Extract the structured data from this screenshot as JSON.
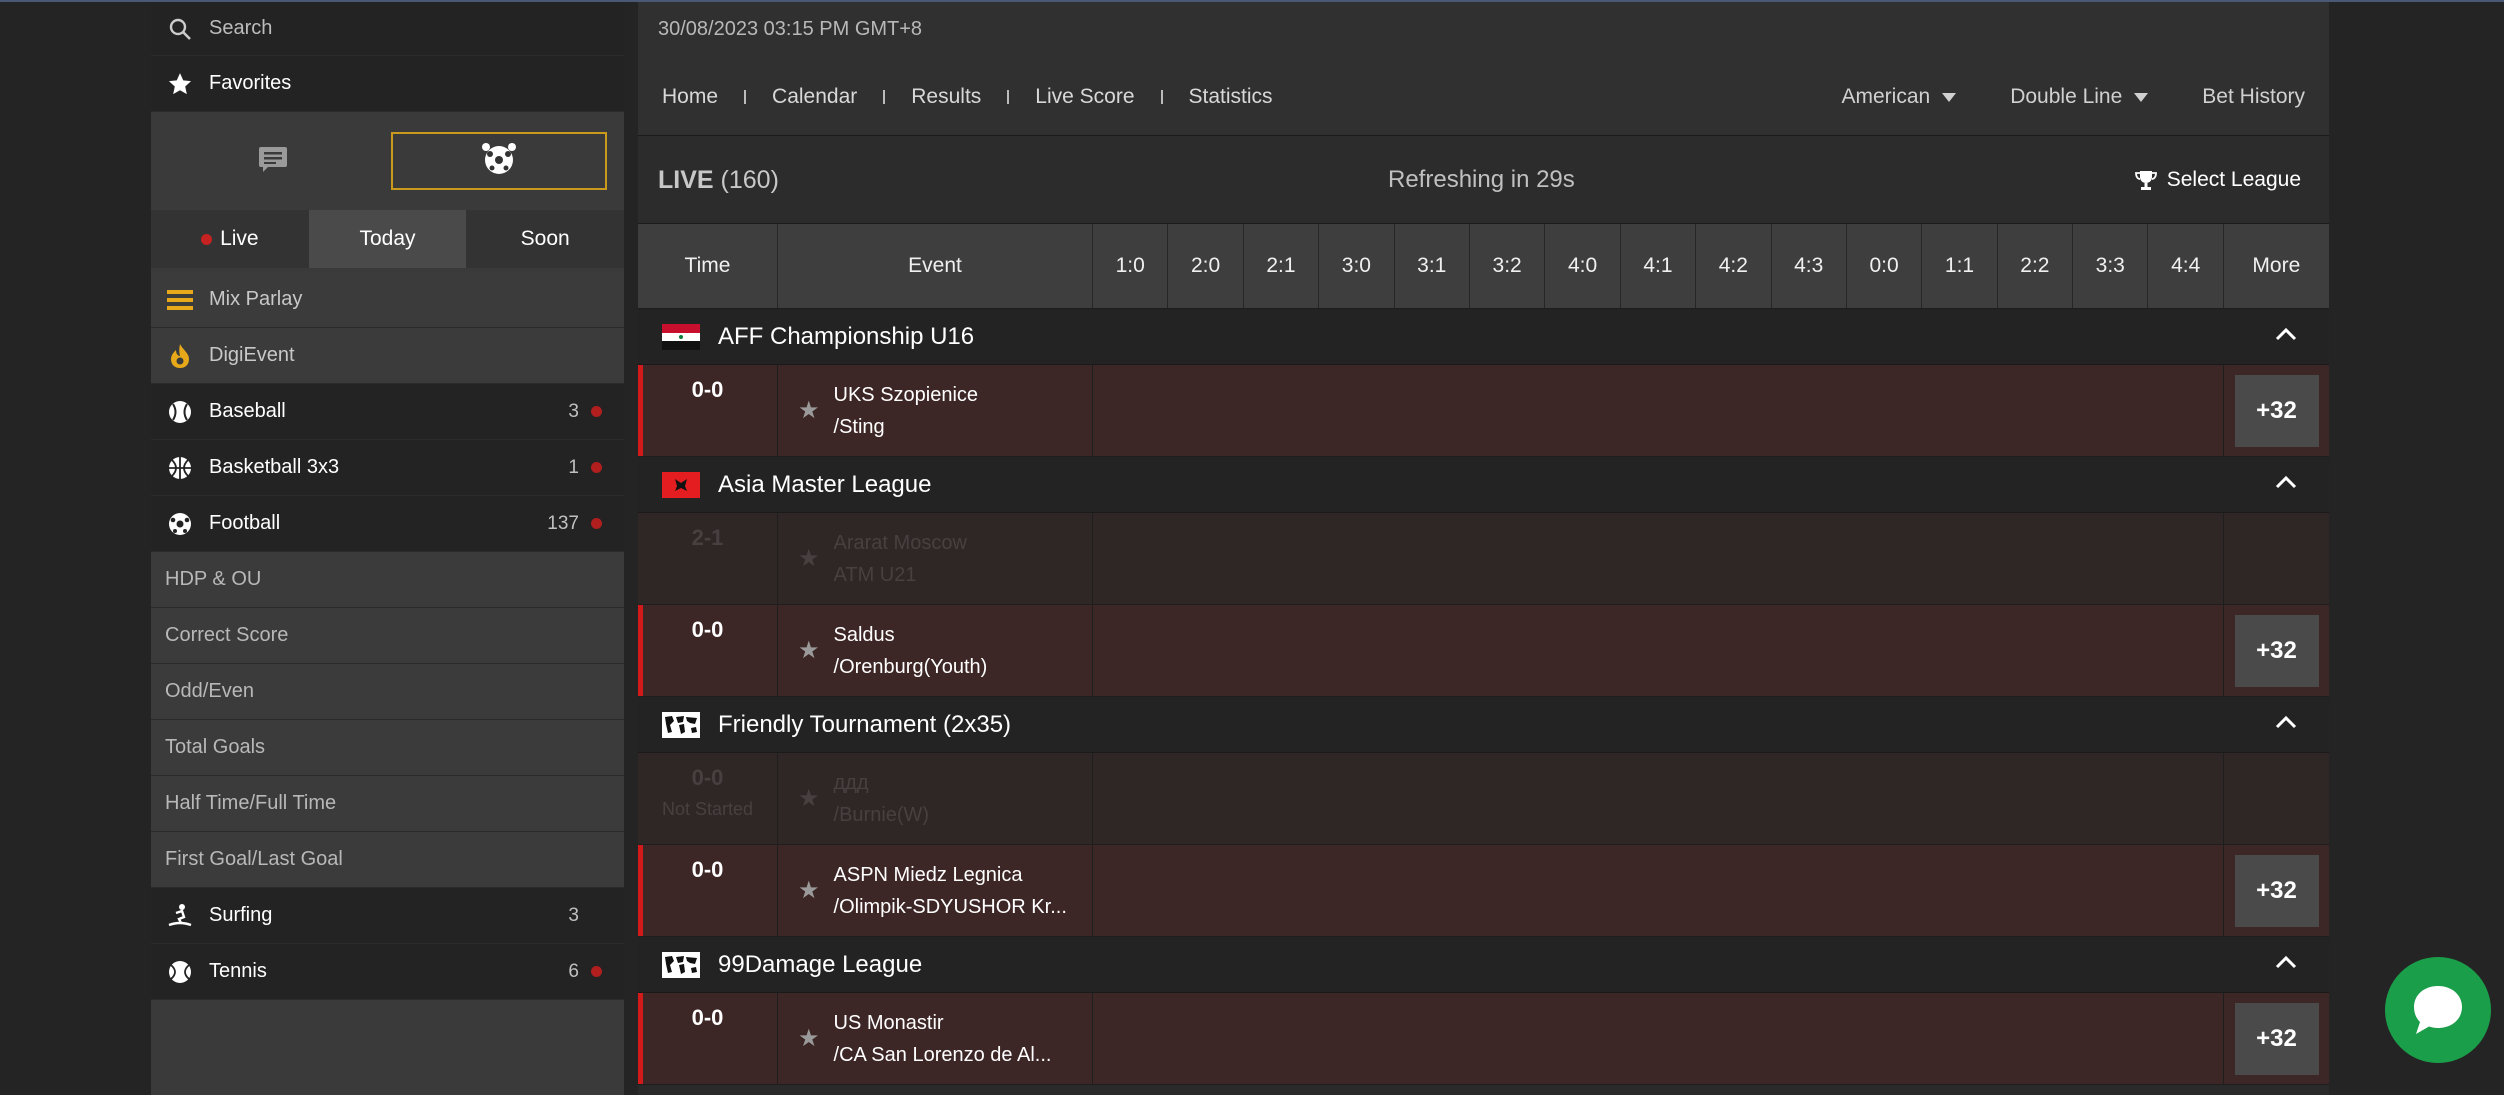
{
  "sidebar": {
    "search_placeholder": "Search",
    "favorites": "Favorites",
    "tabs": [
      {
        "label": "Live"
      },
      {
        "label": "Today"
      },
      {
        "label": "Soon"
      }
    ],
    "items": [
      {
        "label": "Mix Parlay"
      },
      {
        "label": "DigiEvent"
      },
      {
        "label": "Baseball",
        "count": "3"
      },
      {
        "label": "Basketball 3x3",
        "count": "1"
      },
      {
        "label": "Football",
        "count": "137"
      },
      {
        "label": "HDP & OU"
      },
      {
        "label": "Correct Score"
      },
      {
        "label": "Odd/Even"
      },
      {
        "label": "Total Goals"
      },
      {
        "label": "Half Time/Full Time"
      },
      {
        "label": "First Goal/Last Goal"
      },
      {
        "label": "Surfing",
        "count": "3"
      },
      {
        "label": "Tennis",
        "count": "6"
      }
    ]
  },
  "header": {
    "datetime": "30/08/2023 03:15 PM GMT+8",
    "nav": [
      "Home",
      "Calendar",
      "Results",
      "Live Score",
      "Statistics"
    ],
    "odds_format": "American",
    "line_mode": "Double Line",
    "bet_history": "Bet History"
  },
  "livebar": {
    "live": "LIVE",
    "count": "(160)",
    "refresh": "Refreshing in 29s",
    "select_league": "Select League"
  },
  "columns": {
    "time": "Time",
    "event": "Event",
    "scores": [
      "1:0",
      "2:0",
      "2:1",
      "3:0",
      "3:1",
      "3:2",
      "4:0",
      "4:1",
      "4:2",
      "4:3",
      "0:0",
      "1:1",
      "2:2",
      "3:3",
      "4:4"
    ],
    "more": "More"
  },
  "leagues": [
    {
      "name": "AFF Championship U16",
      "matches": [
        {
          "score": "0-0",
          "home": "UKS Szopienice",
          "away": "/Sting",
          "more": "+32"
        }
      ]
    },
    {
      "name": "Asia Master League",
      "matches": [
        {
          "score": "2-1",
          "home": "Ararat Moscow",
          "away": "ATM U21",
          "faded": true
        },
        {
          "score": "0-0",
          "home": "Saldus",
          "away": "/Orenburg(Youth)",
          "more": "+32"
        }
      ]
    },
    {
      "name": "Friendly Tournament (2x35)",
      "matches": [
        {
          "score": "0-0",
          "status": "Not Started",
          "home": "ддд",
          "away": "/Burnie(W)",
          "faded": true
        },
        {
          "score": "0-0",
          "home": "ASPN Miedz Legnica",
          "away": "/Olimpik-SDYUSHOR Kr...",
          "more": "+32"
        }
      ]
    },
    {
      "name": "99Damage League",
      "matches": [
        {
          "score": "0-0",
          "home": "US Monastir",
          "away": "/CA San Lorenzo de Al...",
          "more": "+32"
        }
      ]
    }
  ],
  "colors": {
    "accent": "#c99a1c",
    "live_red": "#d11b1b",
    "chat_green": "#1a9e49"
  }
}
